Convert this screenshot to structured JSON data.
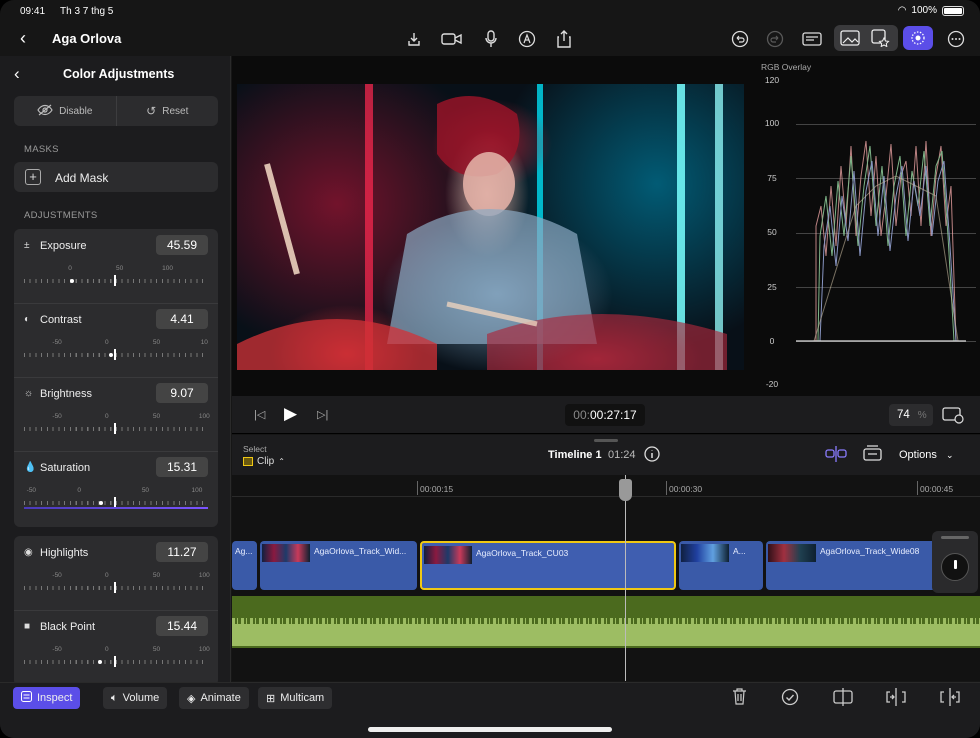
{
  "status": {
    "time": "09:41",
    "date": "Th 3 7 thg 5",
    "battery": "100%"
  },
  "app": {
    "title": "Aga Orlova"
  },
  "panel": {
    "title": "Color Adjustments",
    "disable": "Disable",
    "reset": "Reset",
    "masks_header": "MASKS",
    "add_mask": "Add Mask",
    "adjustments_header": "ADJUSTMENTS",
    "controls": [
      {
        "label": "Exposure",
        "value": "45.59",
        "ticks": [
          "-50",
          "0",
          "50",
          "100"
        ]
      },
      {
        "label": "Contrast",
        "value": "4.41",
        "ticks": [
          "-50",
          "0",
          "50",
          "10"
        ]
      },
      {
        "label": "Brightness",
        "value": "9.07",
        "ticks": [
          "-50",
          "0",
          "50",
          "100"
        ]
      },
      {
        "label": "Saturation",
        "value": "15.31",
        "ticks": [
          "-50",
          "0",
          "50",
          "100"
        ]
      },
      {
        "label": "Highlights",
        "value": "11.27",
        "ticks": [
          "-50",
          "0",
          "50",
          "100"
        ]
      },
      {
        "label": "Black Point",
        "value": "15.44",
        "ticks": [
          "-50",
          "0",
          "50",
          "100"
        ]
      }
    ]
  },
  "scope": {
    "label": "RGB Overlay",
    "ticks": [
      "120",
      "100",
      "75",
      "50",
      "25",
      "0",
      "-20"
    ]
  },
  "transport": {
    "timecode_dim": "00:",
    "timecode": "00:27:17",
    "zoom": "74",
    "zoom_unit": "%"
  },
  "timeline": {
    "select_label": "Select",
    "select_value": "Clip",
    "name": "Timeline 1",
    "duration": "01:24",
    "options": "Options",
    "ruler": [
      "00:00:15",
      "00:00:30",
      "00:00:45"
    ],
    "clips": [
      {
        "name": "Ag..."
      },
      {
        "name": "AgaOrlova_Track_Wid..."
      },
      {
        "name": "AgaOrlova_Track_CU03"
      },
      {
        "name": "A..."
      },
      {
        "name": "AgaOrlova_Track_Wide08"
      }
    ]
  },
  "bottom": {
    "inspect": "Inspect",
    "volume": "Volume",
    "animate": "Animate",
    "multicam": "Multicam"
  },
  "colors": {
    "accent": "#5b4ee8",
    "clip_blue": "#3a5aa8",
    "audio_green": "#4b6a1e",
    "selection_yellow": "#f0c814"
  }
}
